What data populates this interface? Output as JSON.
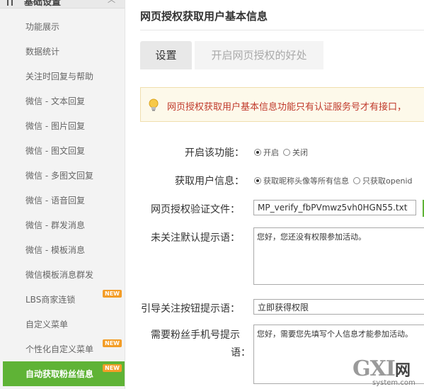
{
  "sidebar": {
    "section_title": "基础设置",
    "items": [
      {
        "label": "功能展示"
      },
      {
        "label": "数据统计"
      },
      {
        "label": "关注时回复与帮助"
      },
      {
        "label": "微信 - 文本回复"
      },
      {
        "label": "微信 - 图片回复"
      },
      {
        "label": "微信 - 图文回复"
      },
      {
        "label": "微信 - 多图文回复"
      },
      {
        "label": "微信 - 语音回复"
      },
      {
        "label": "微信 - 群发消息"
      },
      {
        "label": "微信 - 模板消息"
      },
      {
        "label": "微信模板消息群发"
      },
      {
        "label": "LBS商家连锁",
        "badge": "NEW"
      },
      {
        "label": "自定义菜单"
      },
      {
        "label": "个性化自定义菜单",
        "badge": "NEW"
      },
      {
        "label": "自动获取粉丝信息",
        "badge": "NEW",
        "active": true
      }
    ]
  },
  "main": {
    "title": "网页授权获取用户基本信息",
    "tabs": [
      {
        "label": "设置",
        "active": true
      },
      {
        "label": "开启网页授权的好处",
        "active": false
      }
    ],
    "notice": "网页授权获取用户基本信息功能只有认证服务号才有接口，",
    "form": {
      "enable": {
        "label": "开启该功能：",
        "options": [
          {
            "label": "开启",
            "checked": true
          },
          {
            "label": "关闭",
            "checked": false
          }
        ]
      },
      "get_info": {
        "label": "获取用户信息：",
        "options": [
          {
            "label": "获取昵称头像等所有信息",
            "checked": true
          },
          {
            "label": "只获取openid",
            "checked": false
          }
        ]
      },
      "verify_file": {
        "label": "网页授权验证文件：",
        "value": "MP_verify_fbPVmwz5vh0HGN55.txt"
      },
      "unfollow_tip": {
        "label": "未关注默认提示语：",
        "value": "您好，您还没有权限参加活动。"
      },
      "follow_button_tip": {
        "label": "引导关注按钮提示语：",
        "value": "立即获得权限"
      },
      "phone_tip": {
        "label_line1": "需要粉丝手机号提示",
        "label_line2": "语：",
        "value": "您好，需要您先填写个人信息才能参加活动。"
      }
    }
  },
  "watermark": {
    "big": "GXI",
    "cn": "网",
    "small": "system.com"
  },
  "colors": {
    "accent_green": "#5fb336",
    "badge_orange": "#f39d27",
    "notice_text": "#c0392b",
    "notice_bg": "#fdf9ea"
  }
}
